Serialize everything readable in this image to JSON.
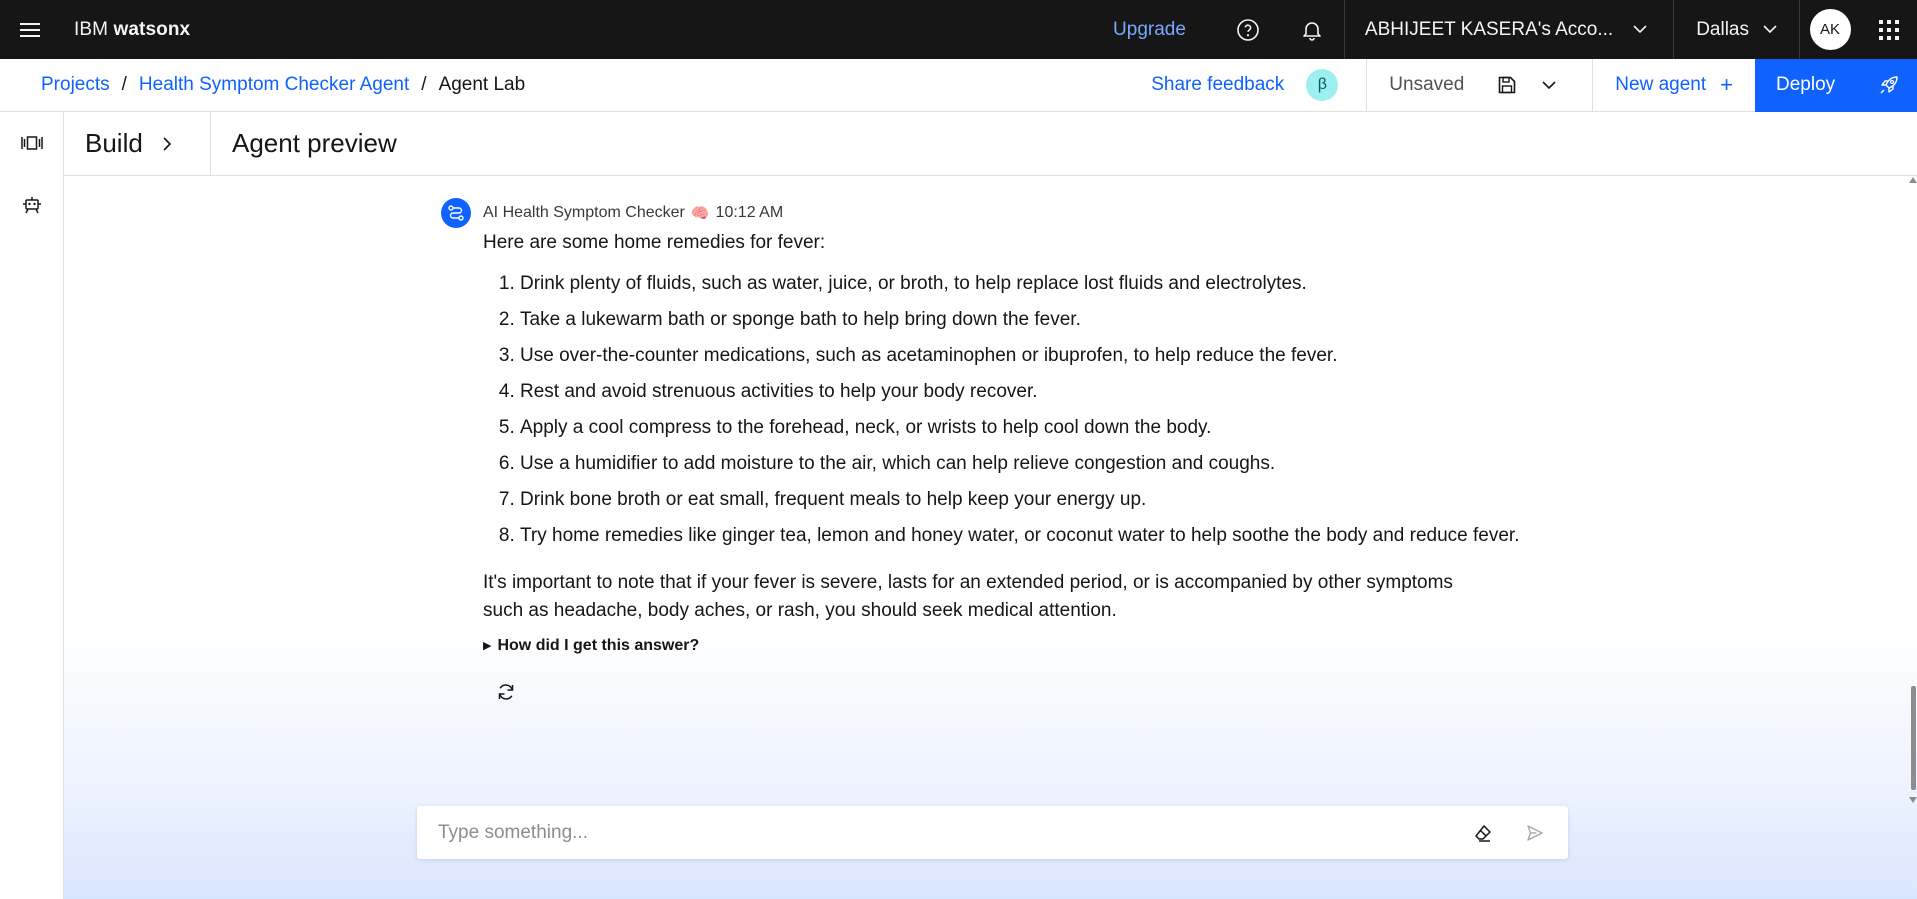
{
  "header": {
    "brand_prefix": "IBM",
    "brand_name": "watsonx",
    "upgrade_label": "Upgrade",
    "account_label": "ABHIJEET KASERA's Acco...",
    "region_label": "Dallas",
    "avatar_initials": "AK"
  },
  "subheader": {
    "breadcrumb": [
      {
        "label": "Projects"
      },
      {
        "label": "Health Symptom Checker Agent"
      },
      {
        "label": "Agent Lab"
      }
    ],
    "separator": "/",
    "share_feedback": "Share feedback",
    "beta_badge": "β",
    "save_status": "Unsaved",
    "new_agent_label": "New agent",
    "new_agent_plus": "+",
    "deploy_label": "Deploy"
  },
  "panel": {
    "build_label": "Build",
    "preview_title": "Agent preview"
  },
  "message": {
    "sender": "AI Health Symptom Checker",
    "emoji": "🧠",
    "time": "10:12 AM",
    "intro": "Here are some home remedies for fever:",
    "items": [
      "Drink plenty of fluids, such as water, juice, or broth, to help replace lost fluids and electrolytes.",
      "Take a lukewarm bath or sponge bath to help bring down the fever.",
      "Use over-the-counter medications, such as acetaminophen or ibuprofen, to help reduce the fever.",
      "Rest and avoid strenuous activities to help your body recover.",
      "Apply a cool compress to the forehead, neck, or wrists to help cool down the body.",
      "Use a humidifier to add moisture to the air, which can help relieve congestion and coughs.",
      "Drink bone broth or eat small, frequent meals to help keep your energy up.",
      "Try home remedies like ginger tea, lemon and honey water, or coconut water to help soothe the body and reduce fever."
    ],
    "note": "It's important to note that if your fever is severe, lasts for an extended period, or is accompanied by other symptoms such as headache, body aches, or rash, you should seek medical attention.",
    "how_label": "How did I get this answer?"
  },
  "composer": {
    "placeholder": "Type something...",
    "value": ""
  },
  "colors": {
    "topbar_bg": "#161616",
    "accent": "#0f62fe",
    "upgrade": "#78a9ff",
    "beta_bg": "#9ef0f0"
  },
  "icons": [
    "menu-icon",
    "help-icon",
    "notification-icon",
    "chevron-down-icon",
    "app-switcher-icon",
    "save-icon",
    "plus-icon",
    "rocket-icon",
    "canvas-icon",
    "robot-icon",
    "chevron-right-icon",
    "agent-flow-icon",
    "regenerate-icon",
    "eraser-icon",
    "send-icon"
  ]
}
